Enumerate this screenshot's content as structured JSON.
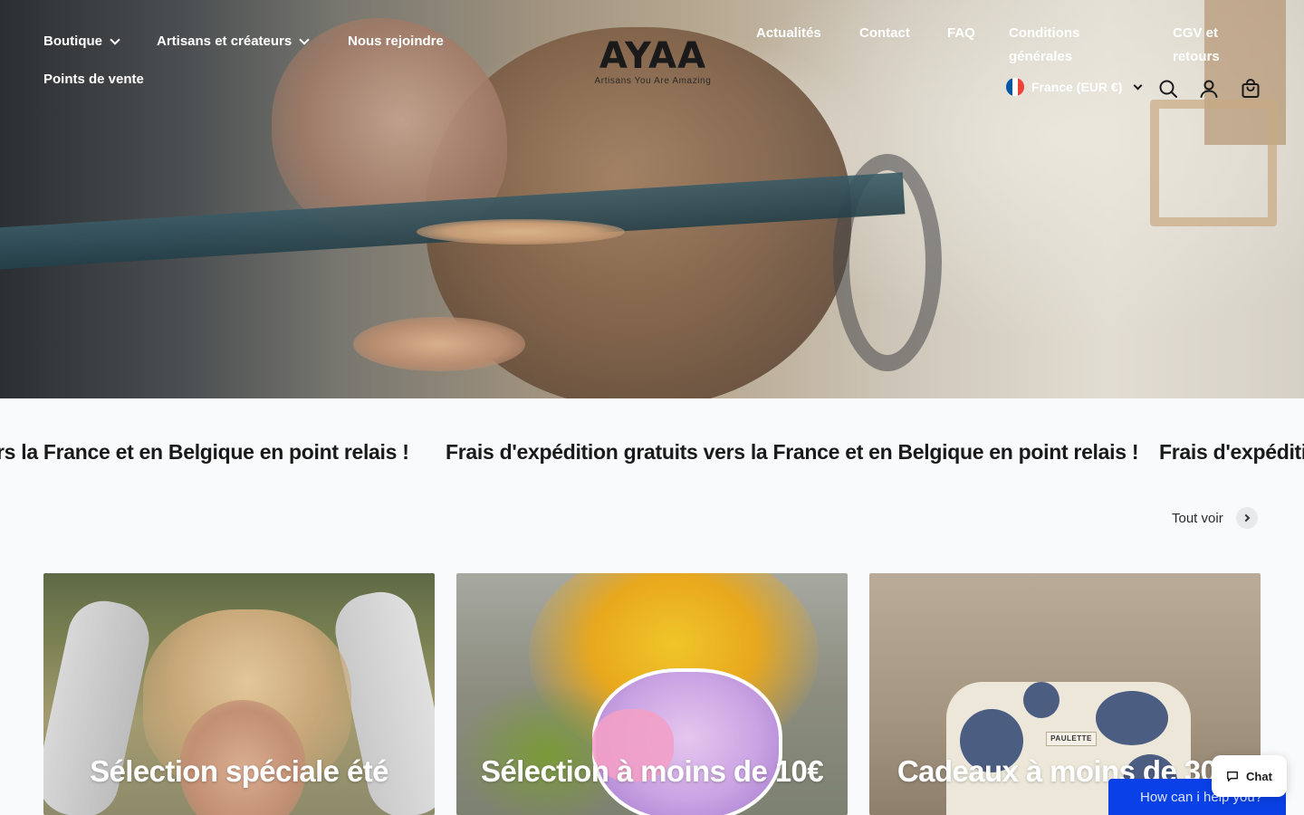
{
  "header": {
    "nav_left": [
      {
        "label": "Boutique",
        "has_dropdown": true
      },
      {
        "label": "Artisans et créateurs",
        "has_dropdown": true
      },
      {
        "label": "Nous rejoindre",
        "has_dropdown": false
      },
      {
        "label": "Points de vente",
        "has_dropdown": false
      }
    ],
    "logo": {
      "title": "AYAA",
      "subtitle": "Artisans You Are Amazing"
    },
    "nav_right": [
      {
        "label": "Actualités"
      },
      {
        "label": "Contact"
      },
      {
        "label": "FAQ"
      },
      {
        "label": "Conditions générales"
      },
      {
        "label": "CGV et retours"
      }
    ],
    "locale": {
      "label": "France (EUR €)",
      "flag_colors": [
        "#0055a4",
        "#ffffff",
        "#ef4135"
      ]
    },
    "icons": [
      "search-icon",
      "account-icon",
      "cart-icon"
    ]
  },
  "marquee": {
    "text_partial_left": "rs la France et en Belgique en point relais !",
    "text_full": "Frais d'expédition gratuits vers la France et en Belgique en point relais !",
    "text_partial_right": "Frais d'expéditic"
  },
  "collections": {
    "view_all_label": "Tout voir",
    "cards": [
      {
        "label": "Sélection spéciale été"
      },
      {
        "label": "Sélection à moins de 10€"
      },
      {
        "label": "Cadeaux à moins de 30€"
      }
    ],
    "bag_tag": "PAULETTE"
  },
  "chat": {
    "button_label": "Chat",
    "banner_text": "How can i help you?",
    "accent": "#0a41e6"
  }
}
